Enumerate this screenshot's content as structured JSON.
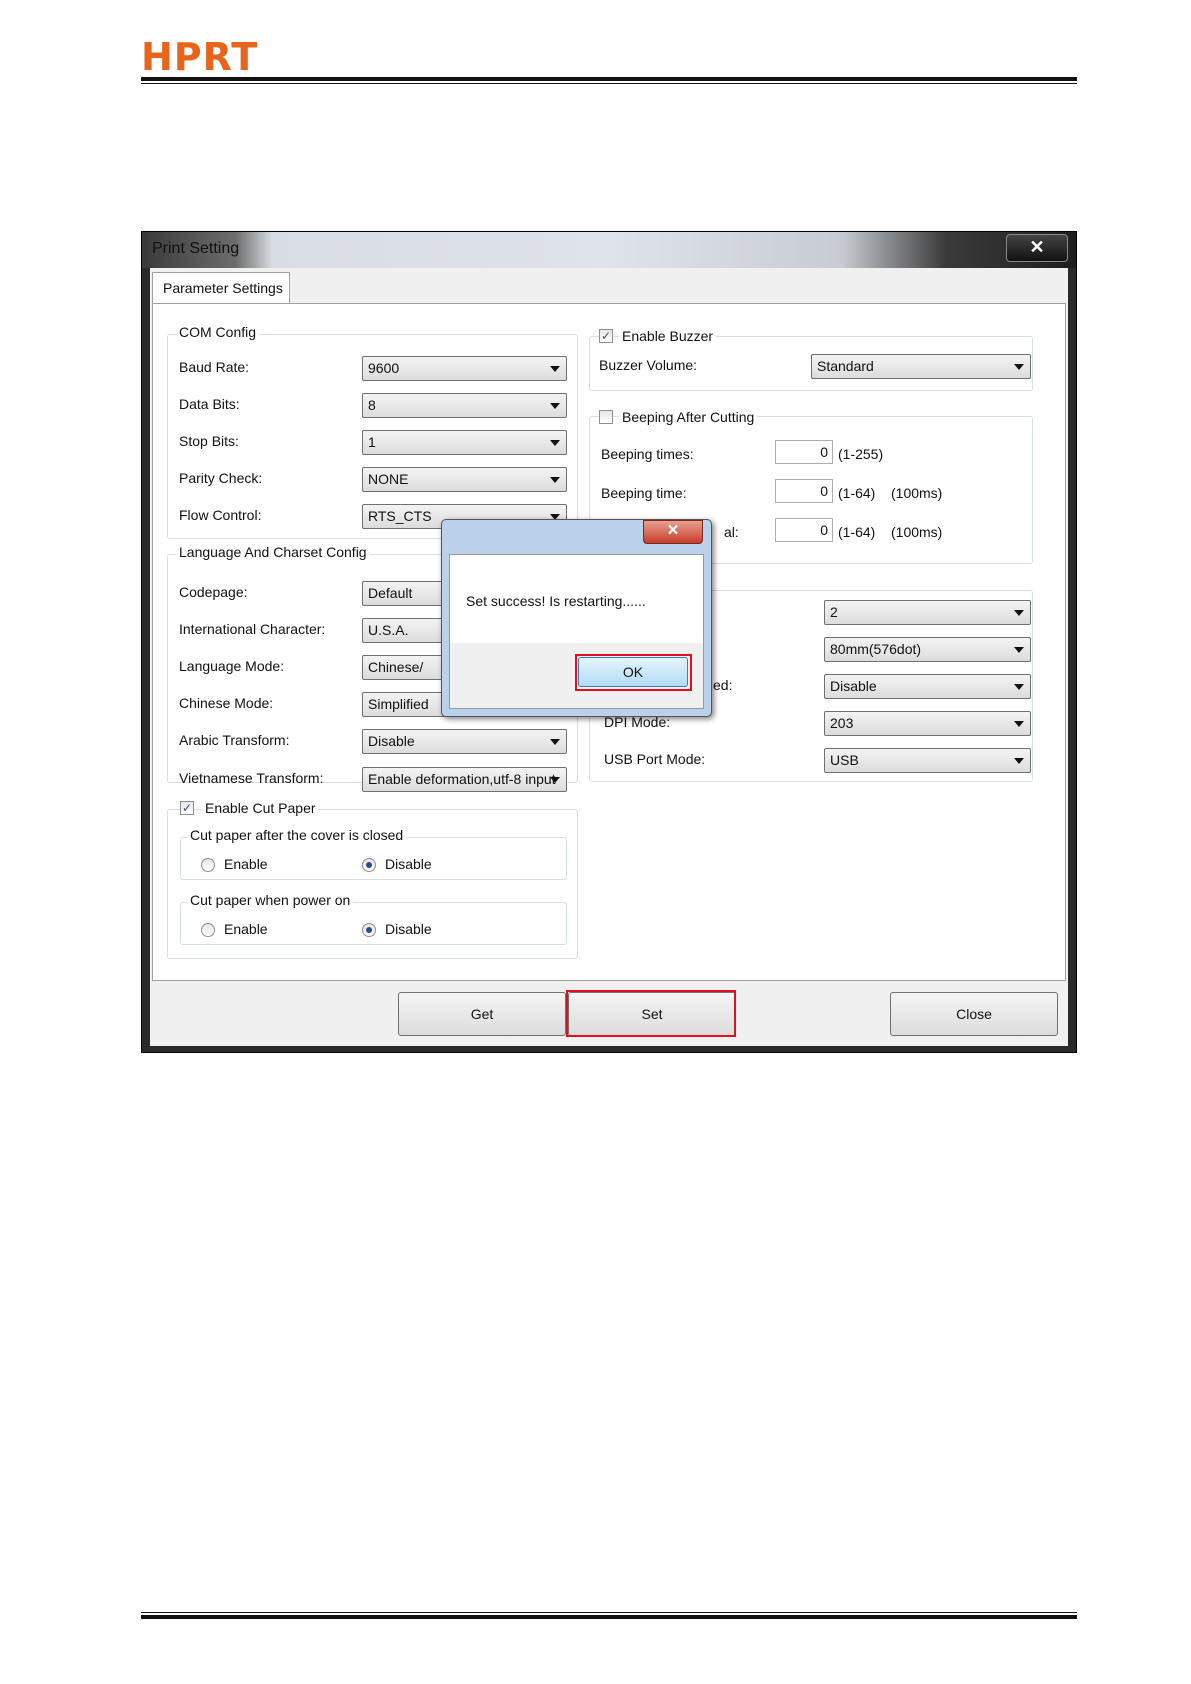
{
  "page": {
    "logo": "HPRT"
  },
  "window": {
    "title": "Print Setting",
    "close_glyph": "✕",
    "tab": "Parameter Settings"
  },
  "com_config": {
    "title": "COM Config",
    "baud_label": "Baud Rate:",
    "baud_value": "9600",
    "data_label": "Data Bits:",
    "data_value": "8",
    "stop_label": "Stop Bits:",
    "stop_value": "1",
    "parity_label": "Parity Check:",
    "parity_value": "NONE",
    "flow_label": "Flow Control:",
    "flow_value": "RTS_CTS"
  },
  "language": {
    "title": "Language And Charset Config",
    "codepage_label": "Codepage:",
    "codepage_value": "Default",
    "intl_label": "International Character:",
    "intl_value": "U.S.A.",
    "mode_label": "Language Mode:",
    "mode_value": "Chinese/",
    "chinese_label": "Chinese Mode:",
    "chinese_value": "Simplified",
    "arabic_label": "Arabic Transform:",
    "arabic_value": "Disable",
    "viet_label": "Vietnamese Transform:",
    "viet_value": "Enable deformation,utf-8 input"
  },
  "cut": {
    "enable_label": "Enable Cut Paper",
    "enable_checked": true,
    "cover_title": "Cut paper after the cover is closed",
    "power_title": "Cut paper when power on",
    "enable_opt": "Enable",
    "disable_opt": "Disable"
  },
  "buzzer": {
    "enable_label": "Enable Buzzer",
    "enable_checked": true,
    "volume_label": "Buzzer Volume:",
    "volume_value": "Standard"
  },
  "beeping": {
    "title": "Beeping After Cutting",
    "checked": false,
    "times_label": "Beeping times:",
    "times_value": "0",
    "times_range": "(1-255)",
    "time_label": "Beeping time:",
    "time_value": "0",
    "time_range": "(1-64)",
    "time_unit": "(100ms)",
    "interval_label_partial": "al:",
    "interval_value": "0",
    "interval_range": "(1-64)",
    "interval_unit": "(100ms)"
  },
  "other": {
    "v1": "2",
    "v2": "80mm(576dot)",
    "label3_partial": "ed:",
    "v3": "Disable",
    "label4_partial": "DPI Mode:",
    "v4": "203",
    "usb_label": "USB Port Mode:",
    "usb_value": "USB"
  },
  "buttons": {
    "get": "Get",
    "set": "Set",
    "close": "Close"
  },
  "dialog": {
    "close_glyph": "✕",
    "message": "Set success! Is restarting......",
    "ok": "OK"
  }
}
